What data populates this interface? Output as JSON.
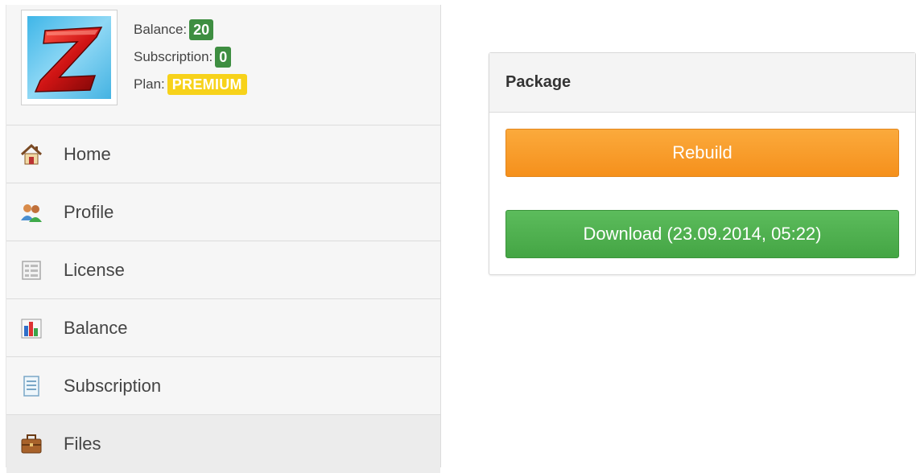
{
  "user": {
    "balance_label": "Balance:",
    "balance_value": "20",
    "subscription_label": "Subscription:",
    "subscription_value": "0",
    "plan_label": "Plan:",
    "plan_value": "PREMIUM"
  },
  "nav": {
    "items": [
      {
        "label": "Home",
        "icon": "home-icon"
      },
      {
        "label": "Profile",
        "icon": "users-icon"
      },
      {
        "label": "License",
        "icon": "license-icon"
      },
      {
        "label": "Balance",
        "icon": "chart-icon"
      },
      {
        "label": "Subscription",
        "icon": "document-icon"
      },
      {
        "label": "Files",
        "icon": "briefcase-icon"
      }
    ],
    "active": "Files"
  },
  "package": {
    "title": "Package",
    "rebuild_label": "Rebuild",
    "download_label": "Download (23.09.2014, 05:22)"
  },
  "colors": {
    "badge_green": "#3e8e41",
    "badge_premium": "#f7d21a",
    "rebuild": "#f5901c",
    "download": "#44a544"
  }
}
